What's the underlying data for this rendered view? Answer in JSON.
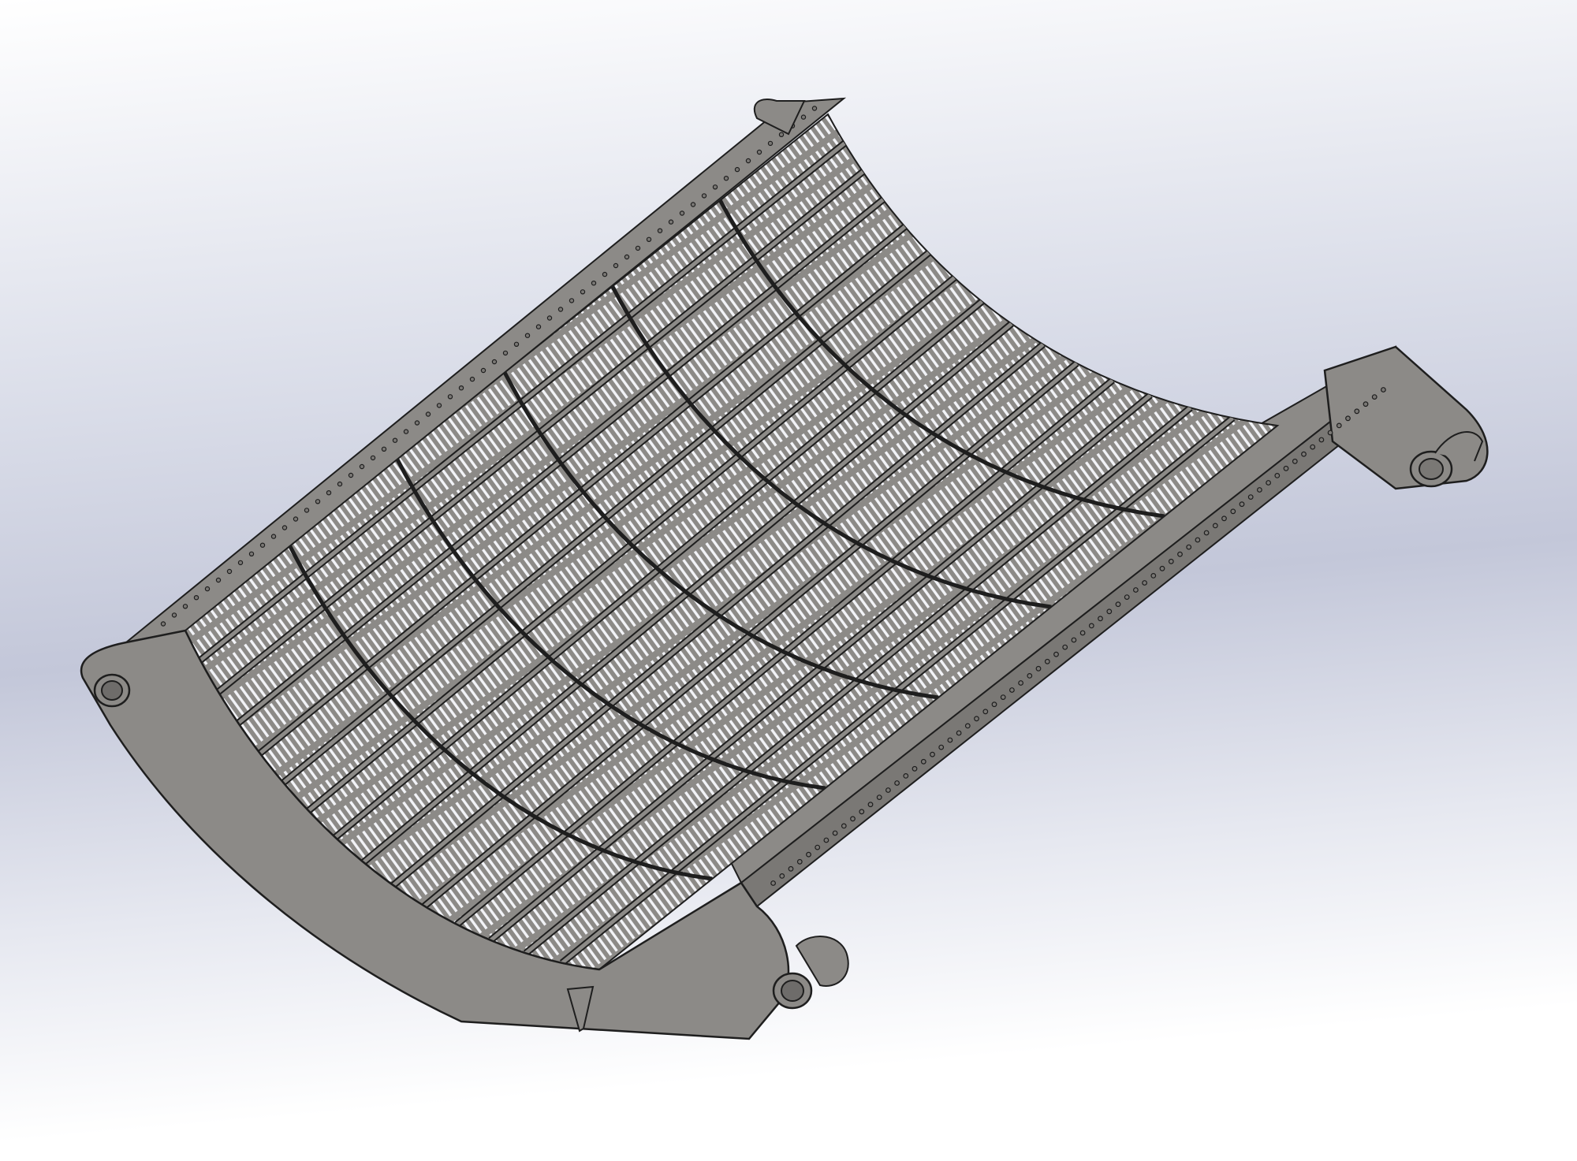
{
  "viewport": {
    "background_top": "#ffffff",
    "background_mid": "#c3c7d9",
    "background_bottom": "#ffffff"
  },
  "model": {
    "part_color": "#8c8a87",
    "part_shade": "#7a7875",
    "edge_color": "#1e1e1e",
    "slot_color": "#f2f3f7",
    "bar_count": 15,
    "rib_count": 6
  }
}
